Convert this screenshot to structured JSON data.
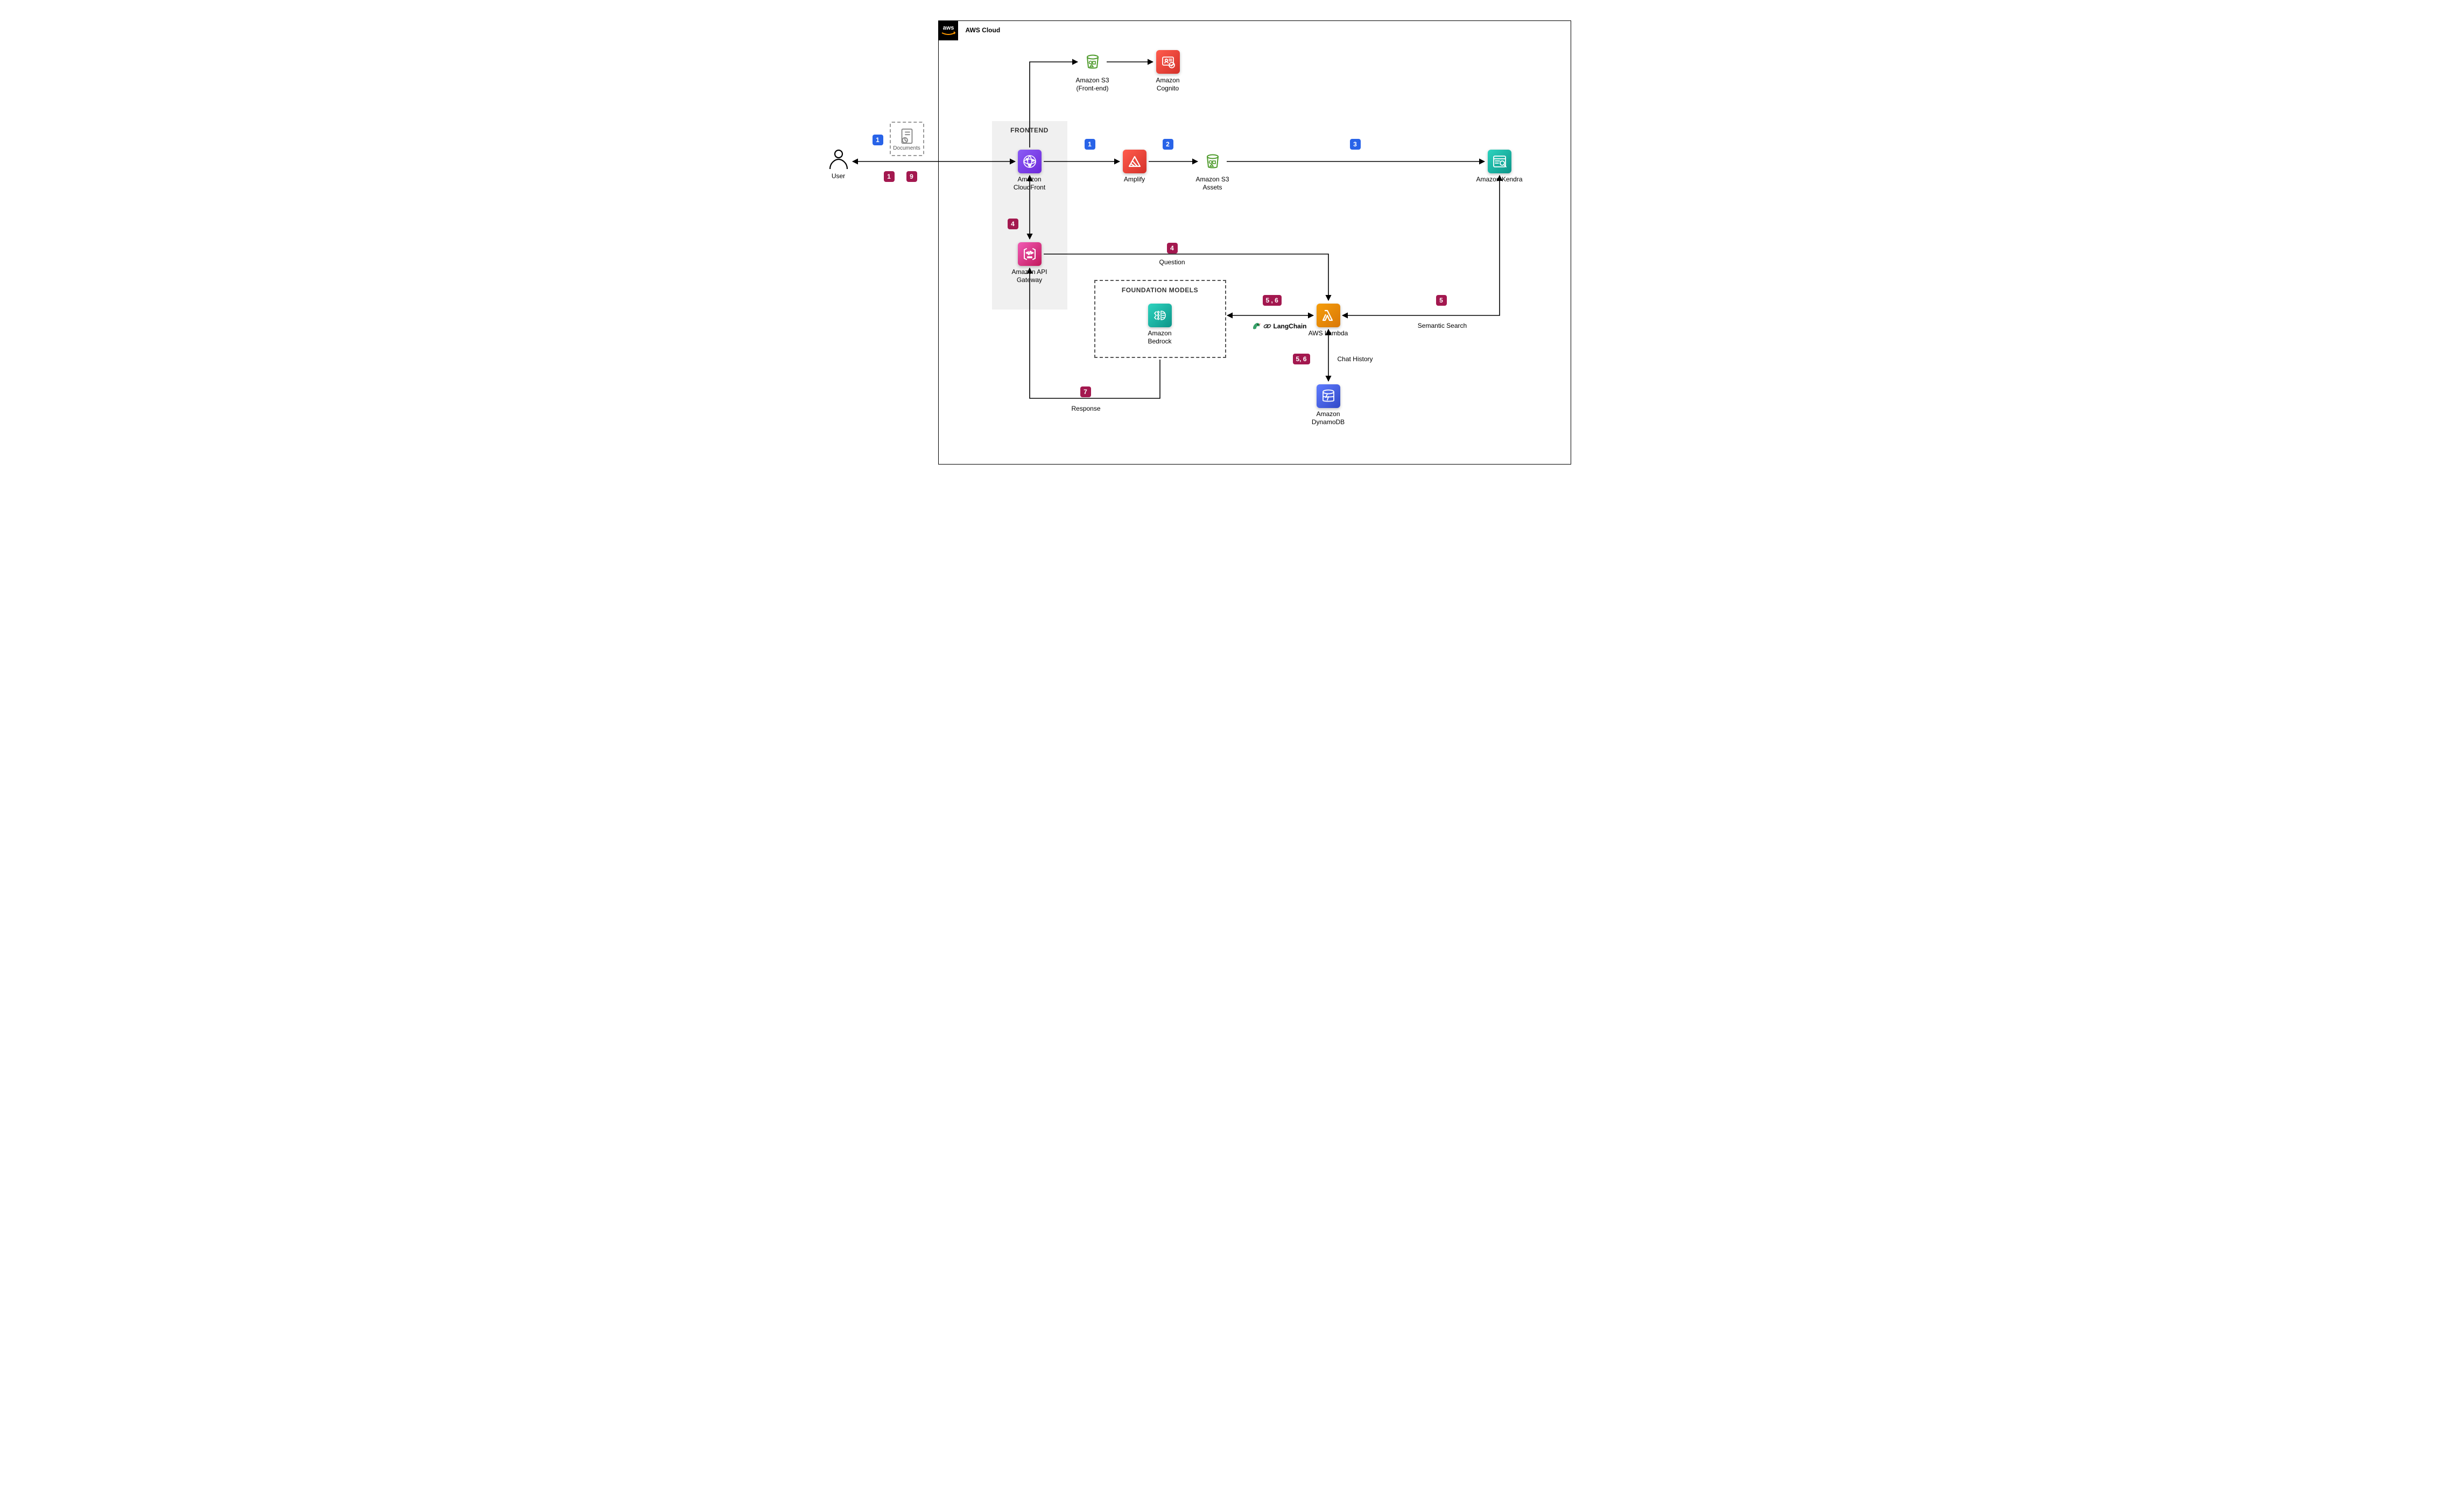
{
  "cloud": {
    "title": "AWS Cloud"
  },
  "groups": {
    "frontend": "FRONTEND",
    "foundation_models": "FOUNDATION MODELS",
    "documents": "Documents"
  },
  "nodes": {
    "user": {
      "label": "User"
    },
    "s3_frontend": {
      "label": "Amazon S3\n(Front-end)"
    },
    "cognito": {
      "label": "Amazon\nCognito"
    },
    "cloudfront": {
      "label": "Amazon\nCloudFront"
    },
    "api_gateway": {
      "label": "Amazon API\nGateway"
    },
    "amplify": {
      "label": "Amplify"
    },
    "s3_assets": {
      "label": "Amazon S3\nAssets"
    },
    "kendra": {
      "label": "Amazon Kendra"
    },
    "bedrock": {
      "label": "Amazon\nBedrock"
    },
    "lambda": {
      "label": "AWS Lambda"
    },
    "dynamodb": {
      "label": "Amazon\nDynamoDB"
    },
    "langchain": {
      "label": "LangChain"
    }
  },
  "edges": {
    "question": "Question",
    "response": "Response",
    "semantic_search": "Semantic Search",
    "chat_history": "Chat History"
  },
  "steps": {
    "blue": [
      "1",
      "1",
      "2",
      "3"
    ],
    "red": [
      "1",
      "9",
      "4",
      "4",
      "5 , 6",
      "5",
      "5, 6",
      "7"
    ]
  },
  "colors": {
    "purple": "#7b3fe4",
    "red": "#e7352c",
    "magenta": "#e63888",
    "orange": "#ed7100",
    "green_s3": "#4d9a2a",
    "teal": "#1e8f7a",
    "blue": "#3b5fe2",
    "step_blue": "#2863e8",
    "step_red": "#a3184f"
  }
}
